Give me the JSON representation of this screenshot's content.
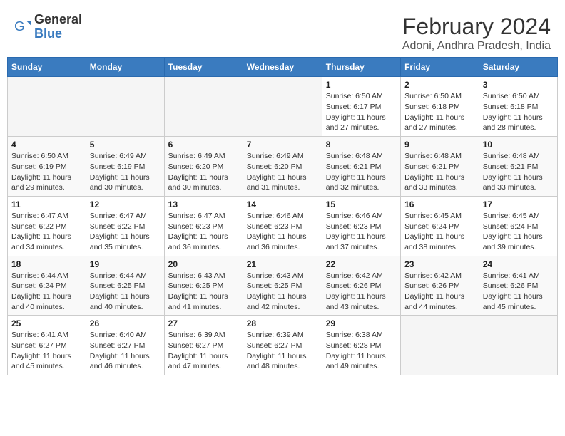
{
  "header": {
    "logo_general": "General",
    "logo_blue": "Blue",
    "month_title": "February 2024",
    "location": "Adoni, Andhra Pradesh, India"
  },
  "days_of_week": [
    "Sunday",
    "Monday",
    "Tuesday",
    "Wednesday",
    "Thursday",
    "Friday",
    "Saturday"
  ],
  "weeks": [
    [
      {
        "day": "",
        "info": ""
      },
      {
        "day": "",
        "info": ""
      },
      {
        "day": "",
        "info": ""
      },
      {
        "day": "",
        "info": ""
      },
      {
        "day": "1",
        "info": "Sunrise: 6:50 AM\nSunset: 6:17 PM\nDaylight: 11 hours\nand 27 minutes."
      },
      {
        "day": "2",
        "info": "Sunrise: 6:50 AM\nSunset: 6:18 PM\nDaylight: 11 hours\nand 27 minutes."
      },
      {
        "day": "3",
        "info": "Sunrise: 6:50 AM\nSunset: 6:18 PM\nDaylight: 11 hours\nand 28 minutes."
      }
    ],
    [
      {
        "day": "4",
        "info": "Sunrise: 6:50 AM\nSunset: 6:19 PM\nDaylight: 11 hours\nand 29 minutes."
      },
      {
        "day": "5",
        "info": "Sunrise: 6:49 AM\nSunset: 6:19 PM\nDaylight: 11 hours\nand 30 minutes."
      },
      {
        "day": "6",
        "info": "Sunrise: 6:49 AM\nSunset: 6:20 PM\nDaylight: 11 hours\nand 30 minutes."
      },
      {
        "day": "7",
        "info": "Sunrise: 6:49 AM\nSunset: 6:20 PM\nDaylight: 11 hours\nand 31 minutes."
      },
      {
        "day": "8",
        "info": "Sunrise: 6:48 AM\nSunset: 6:21 PM\nDaylight: 11 hours\nand 32 minutes."
      },
      {
        "day": "9",
        "info": "Sunrise: 6:48 AM\nSunset: 6:21 PM\nDaylight: 11 hours\nand 33 minutes."
      },
      {
        "day": "10",
        "info": "Sunrise: 6:48 AM\nSunset: 6:21 PM\nDaylight: 11 hours\nand 33 minutes."
      }
    ],
    [
      {
        "day": "11",
        "info": "Sunrise: 6:47 AM\nSunset: 6:22 PM\nDaylight: 11 hours\nand 34 minutes."
      },
      {
        "day": "12",
        "info": "Sunrise: 6:47 AM\nSunset: 6:22 PM\nDaylight: 11 hours\nand 35 minutes."
      },
      {
        "day": "13",
        "info": "Sunrise: 6:47 AM\nSunset: 6:23 PM\nDaylight: 11 hours\nand 36 minutes."
      },
      {
        "day": "14",
        "info": "Sunrise: 6:46 AM\nSunset: 6:23 PM\nDaylight: 11 hours\nand 36 minutes."
      },
      {
        "day": "15",
        "info": "Sunrise: 6:46 AM\nSunset: 6:23 PM\nDaylight: 11 hours\nand 37 minutes."
      },
      {
        "day": "16",
        "info": "Sunrise: 6:45 AM\nSunset: 6:24 PM\nDaylight: 11 hours\nand 38 minutes."
      },
      {
        "day": "17",
        "info": "Sunrise: 6:45 AM\nSunset: 6:24 PM\nDaylight: 11 hours\nand 39 minutes."
      }
    ],
    [
      {
        "day": "18",
        "info": "Sunrise: 6:44 AM\nSunset: 6:24 PM\nDaylight: 11 hours\nand 40 minutes."
      },
      {
        "day": "19",
        "info": "Sunrise: 6:44 AM\nSunset: 6:25 PM\nDaylight: 11 hours\nand 40 minutes."
      },
      {
        "day": "20",
        "info": "Sunrise: 6:43 AM\nSunset: 6:25 PM\nDaylight: 11 hours\nand 41 minutes."
      },
      {
        "day": "21",
        "info": "Sunrise: 6:43 AM\nSunset: 6:25 PM\nDaylight: 11 hours\nand 42 minutes."
      },
      {
        "day": "22",
        "info": "Sunrise: 6:42 AM\nSunset: 6:26 PM\nDaylight: 11 hours\nand 43 minutes."
      },
      {
        "day": "23",
        "info": "Sunrise: 6:42 AM\nSunset: 6:26 PM\nDaylight: 11 hours\nand 44 minutes."
      },
      {
        "day": "24",
        "info": "Sunrise: 6:41 AM\nSunset: 6:26 PM\nDaylight: 11 hours\nand 45 minutes."
      }
    ],
    [
      {
        "day": "25",
        "info": "Sunrise: 6:41 AM\nSunset: 6:27 PM\nDaylight: 11 hours\nand 45 minutes."
      },
      {
        "day": "26",
        "info": "Sunrise: 6:40 AM\nSunset: 6:27 PM\nDaylight: 11 hours\nand 46 minutes."
      },
      {
        "day": "27",
        "info": "Sunrise: 6:39 AM\nSunset: 6:27 PM\nDaylight: 11 hours\nand 47 minutes."
      },
      {
        "day": "28",
        "info": "Sunrise: 6:39 AM\nSunset: 6:27 PM\nDaylight: 11 hours\nand 48 minutes."
      },
      {
        "day": "29",
        "info": "Sunrise: 6:38 AM\nSunset: 6:28 PM\nDaylight: 11 hours\nand 49 minutes."
      },
      {
        "day": "",
        "info": ""
      },
      {
        "day": "",
        "info": ""
      }
    ]
  ]
}
